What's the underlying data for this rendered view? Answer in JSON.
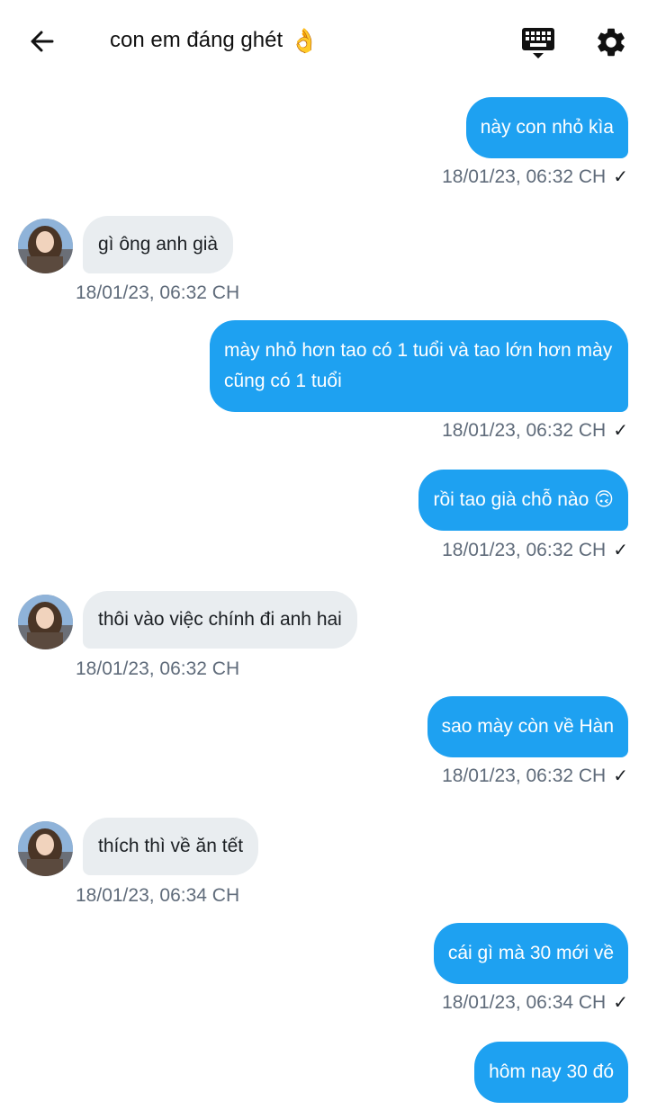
{
  "header": {
    "title": "con em đáng ghét",
    "title_emoji": "👌",
    "icons": [
      "back-arrow-icon",
      "keyboard-icon",
      "gear-icon"
    ]
  },
  "colors": {
    "outgoing_bubble": "#1ea1f1",
    "incoming_bubble": "#e9edf0",
    "timestamp": "#5f6b7a"
  },
  "messages": [
    {
      "dir": "out",
      "text": "này con nhỏ kìa",
      "time": "18/01/23,  06:32 CH",
      "check": "✓"
    },
    {
      "dir": "in",
      "text": "gì ông anh già",
      "time": "18/01/23,  06:32 CH"
    },
    {
      "dir": "out",
      "text": "mày nhỏ hơn tao có 1 tuổi và tao lớn hơn mày cũng có 1 tuổi",
      "time": "18/01/23,  06:32 CH",
      "check": "✓"
    },
    {
      "dir": "out",
      "text": "rồi tao già chỗ nào 🙃",
      "time": "18/01/23,  06:32 CH",
      "check": "✓"
    },
    {
      "dir": "in",
      "text": "thôi vào việc chính đi anh hai",
      "time": "18/01/23,  06:32 CH"
    },
    {
      "dir": "out",
      "text": "sao mày còn về Hàn",
      "time": "18/01/23,  06:32 CH",
      "check": "✓"
    },
    {
      "dir": "in",
      "text": "thích thì về ăn tết",
      "time": "18/01/23,  06:34 CH"
    },
    {
      "dir": "out",
      "text": "cái gì mà 30 mới về",
      "time": "18/01/23,  06:34 CH",
      "check": "✓"
    },
    {
      "dir": "out",
      "text": "hôm nay 30 đó"
    }
  ]
}
